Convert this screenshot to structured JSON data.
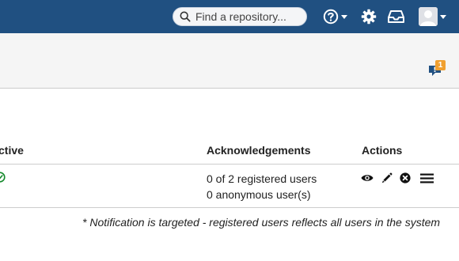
{
  "header": {
    "search": {
      "placeholder": "Find a repository..."
    },
    "icons": [
      "search-icon",
      "help-icon",
      "gear-icon",
      "inbox-icon",
      "user-avatar"
    ],
    "colors": {
      "bar": "#205081"
    }
  },
  "notifications": {
    "count": "1",
    "badge_color": "#f0a030"
  },
  "table": {
    "headers": {
      "active": "ctive",
      "acknowledgements": "Acknowledgements",
      "actions": "Actions"
    },
    "rows": [
      {
        "active_icon": "check-circle-icon",
        "ack_registered": "0 of 2 registered users",
        "ack_anonymous": "0 anonymous user(s)",
        "actions": [
          "view-icon",
          "edit-icon",
          "remove-icon",
          "menu-icon"
        ]
      }
    ]
  },
  "footnote": "* Notification is targeted - registered users reflects all users in the system"
}
